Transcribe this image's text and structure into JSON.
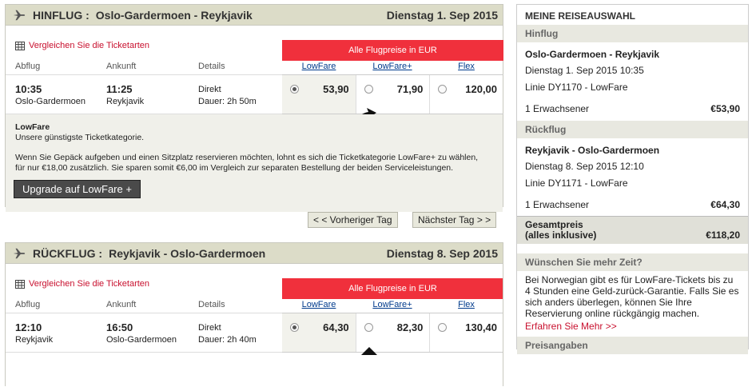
{
  "outbound": {
    "direction": "HINFLUG :",
    "route": "Oslo-Gardermoen - Reykjavik",
    "date": "Dienstag 1. Sep 2015",
    "compare_link": "Vergleichen Sie die Ticketarten",
    "price_banner": "Alle Flugpreise in EUR",
    "col_departure": "Abflug",
    "col_arrival": "Ankunft",
    "col_details": "Details",
    "fares": [
      "LowFare",
      "LowFare+",
      "Flex"
    ],
    "dep_time": "10:35",
    "dep_place": "Oslo-Gardermoen",
    "arr_time": "11:25",
    "arr_place": "Reykjavik",
    "detail_type": "Direkt",
    "detail_duration": "Dauer: 2h 50m",
    "prices": [
      "53,90",
      "71,90",
      "120,00"
    ],
    "selected_fare": 0
  },
  "info_box": {
    "title": "LowFare",
    "subtitle": "Unsere günstigste Ticketkategorie.",
    "text1": "Wenn Sie Gepäck aufgeben und einen Sitzplatz reservieren möchten, lohnt es sich die Ticketkategorie LowFare+ zu wählen,",
    "text2": "für nur €18,00 zusätzlich. Sie sparen somit €6,00 im Vergleich zur separaten Bestellung der beiden Serviceleistungen.",
    "upgrade_button": "Upgrade auf LowFare +"
  },
  "nav": {
    "prev": "< < Vorheriger Tag",
    "next": "Nächster Tag > >"
  },
  "return": {
    "direction": "RÜCKFLUG :",
    "route": "Reykjavik - Oslo-Gardermoen",
    "date": "Dienstag 8. Sep 2015",
    "compare_link": "Vergleichen Sie die Ticketarten",
    "price_banner": "Alle Flugpreise in EUR",
    "col_departure": "Abflug",
    "col_arrival": "Ankunft",
    "col_details": "Details",
    "fares": [
      "LowFare",
      "LowFare+",
      "Flex"
    ],
    "dep_time": "12:10",
    "dep_place": "Reykjavik",
    "arr_time": "16:50",
    "arr_place": "Oslo-Gardermoen",
    "detail_type": "Direkt",
    "detail_duration": "Dauer: 2h 40m",
    "prices": [
      "64,30",
      "82,30",
      "130,40"
    ],
    "selected_fare": 0
  },
  "sidebar": {
    "title": "MEINE REISEAUSWAHL",
    "outbound_header": "Hinflug",
    "outbound_route": "Oslo-Gardermoen - Reykjavik",
    "outbound_datetime": "Dienstag 1. Sep 2015  10:35",
    "outbound_flight": "Linie DY1170 - LowFare",
    "outbound_pax": "1 Erwachsener",
    "outbound_price": "€53,90",
    "return_header": "Rückflug",
    "return_route": "Reykjavik - Oslo-Gardermoen",
    "return_datetime": "Dienstag 8. Sep 2015  12:10",
    "return_flight": "Linie DY1171 - LowFare",
    "return_pax": "1 Erwachsener",
    "return_price": "€64,30",
    "total_label1": "Gesamtpreis",
    "total_label2": "(alles inklusive)",
    "total_price": "€118,20",
    "more_time_header": "Wünschen Sie mehr Zeit?",
    "more_time_text": "Bei Norwegian gibt es für LowFare-Tickets bis zu 4 Stunden eine Geld-zurück-Garantie. Falls Sie es sich anders überlegen, können Sie Ihre Reservierung online rückgängig machen.",
    "more_link": "Erfahren Sie Mehr >>",
    "price_info_header": "Preisangaben"
  },
  "colors": {
    "accent_red": "#f0303c",
    "header_bg": "#dcdcc8",
    "link_blue": "#003a8c"
  }
}
